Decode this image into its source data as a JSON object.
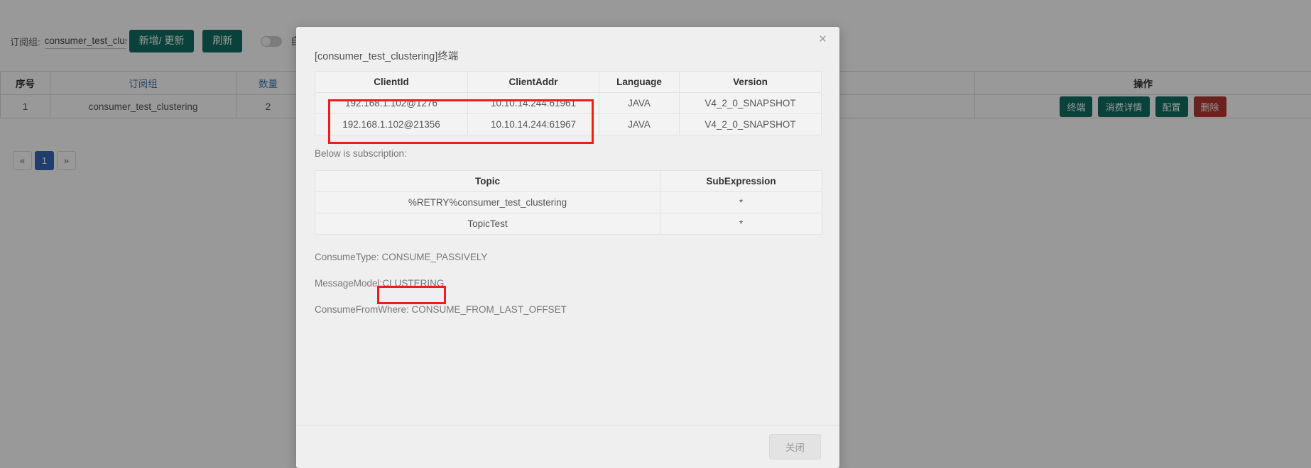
{
  "toolbar": {
    "group_label": "订阅组:",
    "group_value": "consumer_test_clustering",
    "group_placeholder": "consumer_test_clustering",
    "add_update_label": "新增/ 更新",
    "refresh_label": "刷新",
    "auto_refresh_label": "自动刷新",
    "auto_refresh_on": false
  },
  "main_table": {
    "headers": [
      "序号",
      "订阅组",
      "数量",
      "",
      "",
      "操作"
    ],
    "rows": [
      {
        "index": "1",
        "group": "consumer_test_clustering",
        "count": "2",
        "col4": "",
        "col5": "",
        "actions": [
          "终端",
          "消费详情",
          "配置",
          "删除"
        ]
      }
    ]
  },
  "pagination": {
    "prev": "«",
    "pages": [
      "1"
    ],
    "next": "»",
    "current": "1"
  },
  "modal": {
    "title": "[consumer_test_clustering]终端",
    "close_icon": "×",
    "client_table": {
      "headers": [
        "ClientId",
        "ClientAddr",
        "Language",
        "Version"
      ],
      "rows": [
        {
          "client_id": "192.168.1.102@1276",
          "client_addr": "10.10.14.244:61961",
          "language": "JAVA",
          "version": "V4_2_0_SNAPSHOT"
        },
        {
          "client_id": "192.168.1.102@21356",
          "client_addr": "10.10.14.244:61967",
          "language": "JAVA",
          "version": "V4_2_0_SNAPSHOT"
        }
      ]
    },
    "subscription_note": "Below is subscription:",
    "subscription_table": {
      "headers": [
        "Topic",
        "SubExpression"
      ],
      "rows": [
        {
          "topic": "%RETRY%consumer_test_clustering",
          "sub_expression": "*"
        },
        {
          "topic": "TopicTest",
          "sub_expression": "*"
        }
      ]
    },
    "consume_type": "ConsumeType: CONSUME_PASSIVELY",
    "message_model_label": "MessageModel:",
    "message_model_value": "CLUSTERING",
    "consume_from_where": "ConsumeFromWhere: CONSUME_FROM_LAST_OFFSET",
    "footer_close_label": "关闭"
  },
  "colors": {
    "teal": "#0f6e62",
    "red": "#b03a32",
    "highlight": "#ee1c1c",
    "link": "#3a7bb5",
    "pager_active": "#3a66b5"
  }
}
